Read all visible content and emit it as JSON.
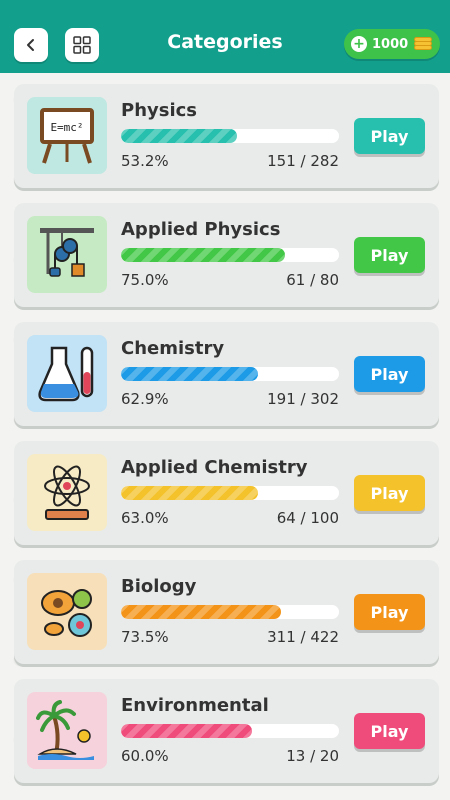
{
  "header": {
    "title": "Categories",
    "coins": "1000",
    "back_icon": "chevron-left-icon",
    "grid_icon": "grid-icon"
  },
  "categories": [
    {
      "name": "Physics",
      "percent": "53.2%",
      "count": "151 / 282",
      "progress": 0.532,
      "play_label": "Play",
      "color": "#27c0ae",
      "thumb_bg": "#bfe8e2",
      "icon": "chalkboard-emc2-icon"
    },
    {
      "name": "Applied Physics",
      "percent": "75.0%",
      "count": "61 / 80",
      "progress": 0.75,
      "play_label": "Play",
      "color": "#42c846",
      "thumb_bg": "#c6ebc4",
      "icon": "pulley-icon"
    },
    {
      "name": "Chemistry",
      "percent": "62.9%",
      "count": "191 / 302",
      "progress": 0.629,
      "play_label": "Play",
      "color": "#1e9be6",
      "thumb_bg": "#c2e2f6",
      "icon": "flask-icon"
    },
    {
      "name": "Applied Chemistry",
      "percent": "63.0%",
      "count": "64 / 100",
      "progress": 0.63,
      "play_label": "Play",
      "color": "#f4c22b",
      "thumb_bg": "#f6ebc4",
      "icon": "atom-book-icon"
    },
    {
      "name": "Biology",
      "percent": "73.5%",
      "count": "311 / 422",
      "progress": 0.735,
      "play_label": "Play",
      "color": "#f39418",
      "thumb_bg": "#f6dfb9",
      "icon": "cells-icon"
    },
    {
      "name": "Environmental",
      "percent": "60.0%",
      "count": "13 / 20",
      "progress": 0.6,
      "play_label": "Play",
      "color": "#ef4b7b",
      "thumb_bg": "#f6d2dc",
      "icon": "palm-island-icon"
    }
  ]
}
